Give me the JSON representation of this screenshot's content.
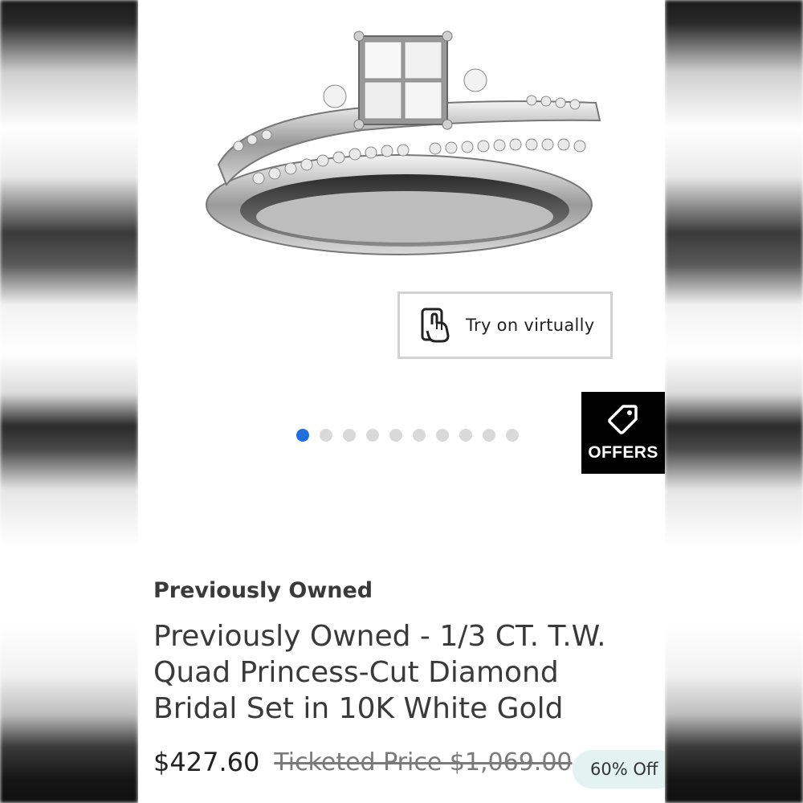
{
  "product": {
    "image_alt": "ring-photo",
    "try_on_label": "Try on virtually",
    "carousel": {
      "total": 10,
      "active_index": 0
    },
    "offers_label": "OFFERS",
    "condition": "Previously Owned",
    "title": "Previously Owned - 1/3 CT. T.W. Quad Princess-Cut Diamond Bridal Set in 10K White Gold",
    "price": "$427.60",
    "ticketed_price": "Ticketed Price $1,069.00",
    "discount": "60% Off"
  },
  "colors": {
    "active_dot": "#1f6fe0",
    "inactive_dot": "#d9d9d9",
    "offers_bg": "#000000",
    "discount_bg": "#e3f3f2"
  }
}
